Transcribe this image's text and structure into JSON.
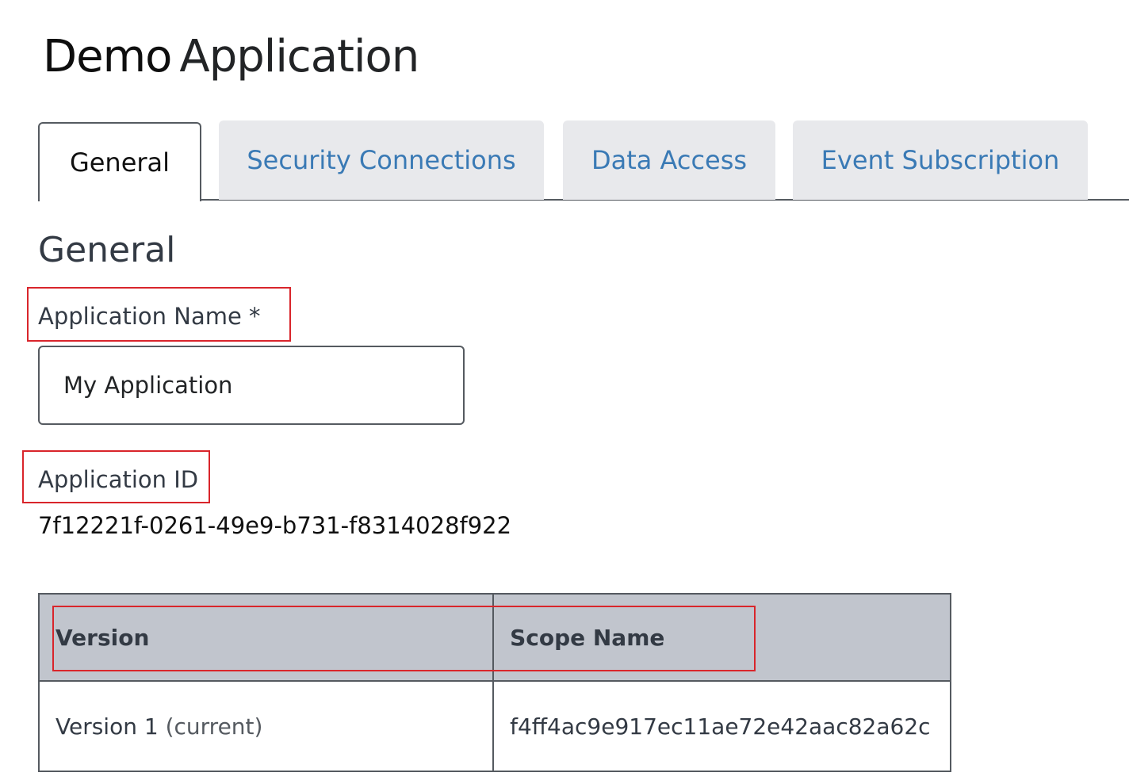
{
  "header": {
    "title_part1": "Demo",
    "title_part2": "Application"
  },
  "tabs": [
    {
      "label": "General",
      "active": true
    },
    {
      "label": "Security Connections",
      "active": false
    },
    {
      "label": "Data Access",
      "active": false
    },
    {
      "label": "Event Subscription",
      "active": false
    }
  ],
  "general": {
    "section_title": "General",
    "name_label": "Application Name *",
    "name_value": "My Application",
    "id_label": "Application ID",
    "id_value": "7f12221f-0261-49e9-b731-f8314028f922"
  },
  "versions_table": {
    "headers": [
      "Version",
      "Scope Name"
    ],
    "rows": [
      {
        "version": "Version 1",
        "version_note": "(current)",
        "scope": "f4ff4ac9e917ec11ae72e42aac82a62c"
      }
    ]
  },
  "colors": {
    "highlight": "#d9252b",
    "tab_link": "#3a7ab5",
    "tab_inactive_bg": "#e8e9ec",
    "table_header_bg": "#c1c5cd"
  }
}
